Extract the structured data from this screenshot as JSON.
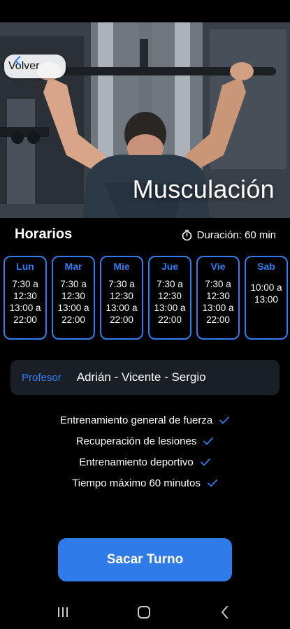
{
  "header": {
    "back_label": "Volver",
    "title": "Musculación"
  },
  "schedule": {
    "title": "Horarios",
    "duration": "Duración: 60 min",
    "days": [
      {
        "name": "Lun",
        "times": [
          "7:30 a",
          "12:30",
          "13:00 a",
          "22:00"
        ]
      },
      {
        "name": "Mar",
        "times": [
          "7:30 a",
          "12:30",
          "13:00 a",
          "22:00"
        ]
      },
      {
        "name": "Mie",
        "times": [
          "7:30 a",
          "12:30",
          "13:00 a",
          "22:00"
        ]
      },
      {
        "name": "Jue",
        "times": [
          "7:30 a",
          "12:30",
          "13:00 a",
          "22:00"
        ]
      },
      {
        "name": "Vie",
        "times": [
          "7:30 a",
          "12:30",
          "13:00 a",
          "22:00"
        ]
      },
      {
        "name": "Sab",
        "times": [
          "10:00 a",
          "13:00"
        ]
      }
    ]
  },
  "teacher": {
    "label": "Profesor",
    "names": "Adrián - Vicente - Sergio"
  },
  "features": [
    "Entrenamiento general de fuerza",
    "Recuperación de lesiones",
    "Entrenamiento deportivo",
    "Tiempo máximo 60 minutos"
  ],
  "cta": {
    "label": "Sacar Turno"
  },
  "icons": {
    "back": "chevron-left-icon",
    "timer": "stopwatch-icon",
    "check": "check-icon",
    "nav": [
      "recent-apps-icon",
      "home-icon",
      "back-icon"
    ]
  },
  "colors": {
    "accent": "#2f7df2",
    "button": "#2f7be8",
    "background": "#000000",
    "card": "#1a1f26"
  }
}
